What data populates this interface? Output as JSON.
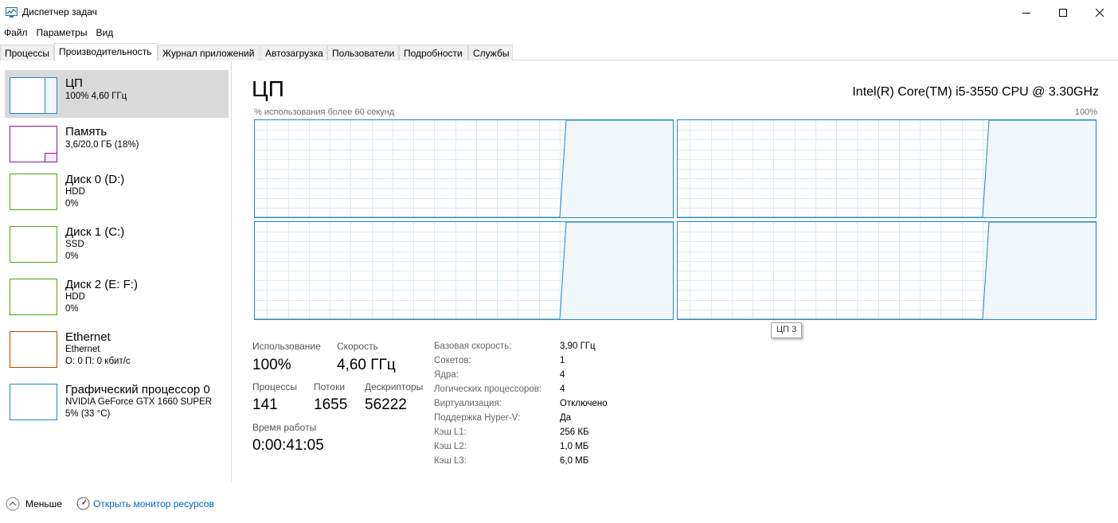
{
  "window": {
    "title": "Диспетчер задач"
  },
  "menu": [
    "Файл",
    "Параметры",
    "Вид"
  ],
  "tabs": [
    "Процессы",
    "Производительность",
    "Журнал приложений",
    "Автозагрузка",
    "Пользователи",
    "Подробности",
    "Службы"
  ],
  "active_tab": "Производительность",
  "sidebar": [
    {
      "name": "ЦП",
      "line1": "100%  4,60 ГГц",
      "line2": "",
      "color": "#1f86c6",
      "selected": true
    },
    {
      "name": "Память",
      "line1": "3,6/20,0 ГБ (18%)",
      "line2": "",
      "color": "#8b12ae"
    },
    {
      "name": "Диск 0 (D:)",
      "line1": "HDD",
      "line2": "0%",
      "color": "#4da60c"
    },
    {
      "name": "Диск 1 (C:)",
      "line1": "SSD",
      "line2": "0%",
      "color": "#4da60c"
    },
    {
      "name": "Диск 2 (E: F:)",
      "line1": "HDD",
      "line2": "0%",
      "color": "#4da60c"
    },
    {
      "name": "Ethernet",
      "line1": "Ethernet",
      "line2": "О: 0 П: 0 кбит/с",
      "color": "#a74f01"
    },
    {
      "name": "Графический процессор 0",
      "line1": "NVIDIA GeForce GTX 1660 SUPER",
      "line2": "5%  (33 °C)",
      "color": "#1f86c6"
    }
  ],
  "main": {
    "title": "ЦП",
    "cpu_model": "Intel(R) Core(TM) i5-3550 CPU @ 3.30GHz",
    "graph_label": "% использования более 60 секунд",
    "graph_max": "100%",
    "tooltip": "ЦП 3",
    "accent_color": "#1f86c6"
  },
  "stats": {
    "usage_label": "Использование",
    "usage_value": "100%",
    "speed_label": "Скорость",
    "speed_value": "4,60 ГГц",
    "processes_label": "Процессы",
    "processes_value": "141",
    "threads_label": "Потоки",
    "threads_value": "1655",
    "handles_label": "Дескрипторы",
    "handles_value": "56222",
    "uptime_label": "Время работы",
    "uptime_value": "0:00:41:05"
  },
  "info": [
    {
      "label": "Базовая скорость:",
      "value": "3,90 ГГц"
    },
    {
      "label": "Сокетов:",
      "value": "1"
    },
    {
      "label": "Ядра:",
      "value": "4"
    },
    {
      "label": "Логических процессоров:",
      "value": "4"
    },
    {
      "label": "Виртуализация:",
      "value": "Отключено"
    },
    {
      "label": "Поддержка Hyper-V:",
      "value": "Да"
    },
    {
      "label": "Кэш L1:",
      "value": "256 КБ"
    },
    {
      "label": "Кэш L2:",
      "value": "1,0 МБ"
    },
    {
      "label": "Кэш L3:",
      "value": "6,0 МБ"
    }
  ],
  "footer": {
    "less_label": "Меньше",
    "resource_monitor_link": "Открыть монитор ресурсов"
  }
}
